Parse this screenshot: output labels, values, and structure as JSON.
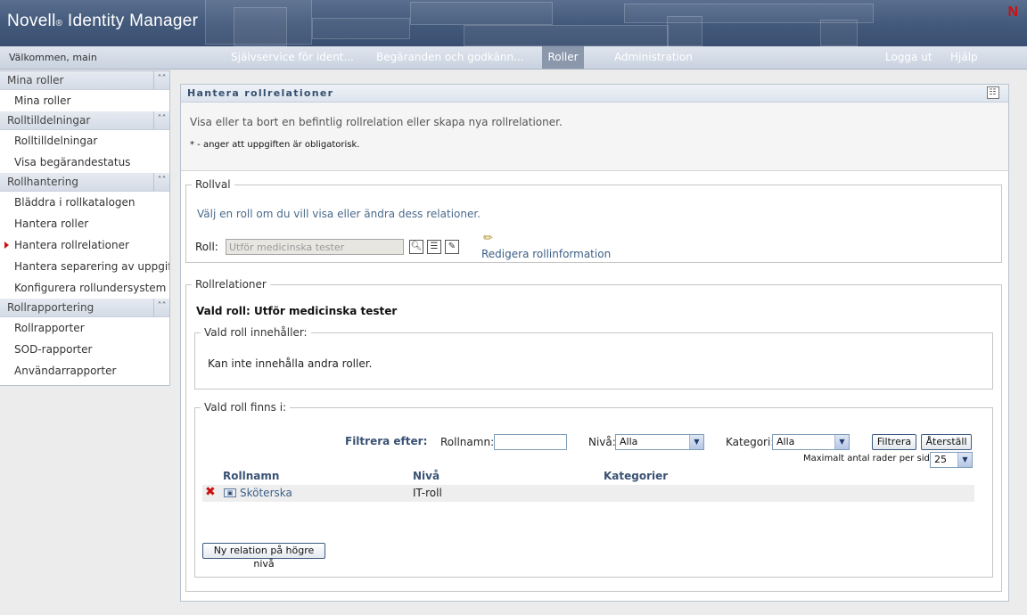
{
  "header": {
    "brand": "Novell",
    "brand_reg": "®",
    "product": "Identity Manager",
    "logo_letter": "N"
  },
  "nav": {
    "welcome": "Välkommen, main",
    "tabs": [
      {
        "label": "Självservice för ident..."
      },
      {
        "label": "Begäranden och godkänn..."
      },
      {
        "label": "Roller"
      },
      {
        "label": "Administration"
      }
    ],
    "logout": "Logga ut",
    "help": "Hjälp"
  },
  "sidebar": {
    "sections": [
      {
        "title": "Mina roller",
        "items": [
          "Mina roller"
        ]
      },
      {
        "title": "Rolltilldelningar",
        "items": [
          "Rolltilldelningar",
          "Visa begärandestatus"
        ]
      },
      {
        "title": "Rollhantering",
        "items": [
          "Bläddra i rollkatalogen",
          "Hantera roller",
          "Hantera rollrelationer",
          "Hantera separering av uppgifter",
          "Konfigurera rollundersystem"
        ]
      },
      {
        "title": "Rollrapportering",
        "items": [
          "Rollrapporter",
          "SOD-rapporter",
          "Användarrapporter"
        ]
      }
    ]
  },
  "panel": {
    "title": "Hantera rollrelationer",
    "description": "Visa eller ta bort en befintlig rollrelation eller skapa nya rollrelationer.",
    "required_note": "* - anger att uppgiften är obligatorisk."
  },
  "rollval": {
    "legend": "Rollval",
    "hint": "Välj en roll om du vill visa eller ändra dess relationer.",
    "role_label": "Roll:",
    "role_value": "Utför medicinska tester",
    "edit_link": "Redigera rollinformation"
  },
  "relations": {
    "legend": "Rollrelationer",
    "selected_role": "Vald roll: Utför medicinska tester",
    "contains_legend": "Vald roll innehåller:",
    "contains_text": "Kan inte innehålla andra roller.",
    "exists_legend": "Vald roll finns i:",
    "filter": {
      "title": "Filtrera efter:",
      "name_label": "Rollnamn:",
      "name_value": "",
      "level_label": "Nivå:",
      "level_value": "Alla",
      "category_label": "Kategori:",
      "category_value": "Alla",
      "filter_button": "Filtrera",
      "reset_button": "Återställ",
      "max_rows_label": "Maximalt antal rader per sida",
      "max_rows_value": "25"
    },
    "table": {
      "headers": [
        "Rollnamn",
        "Nivå",
        "Kategorier"
      ],
      "rows": [
        {
          "name": "Sköterska",
          "level": "IT-roll",
          "category": ""
        }
      ]
    },
    "new_relation_button": "Ny relation på högre nivå"
  }
}
